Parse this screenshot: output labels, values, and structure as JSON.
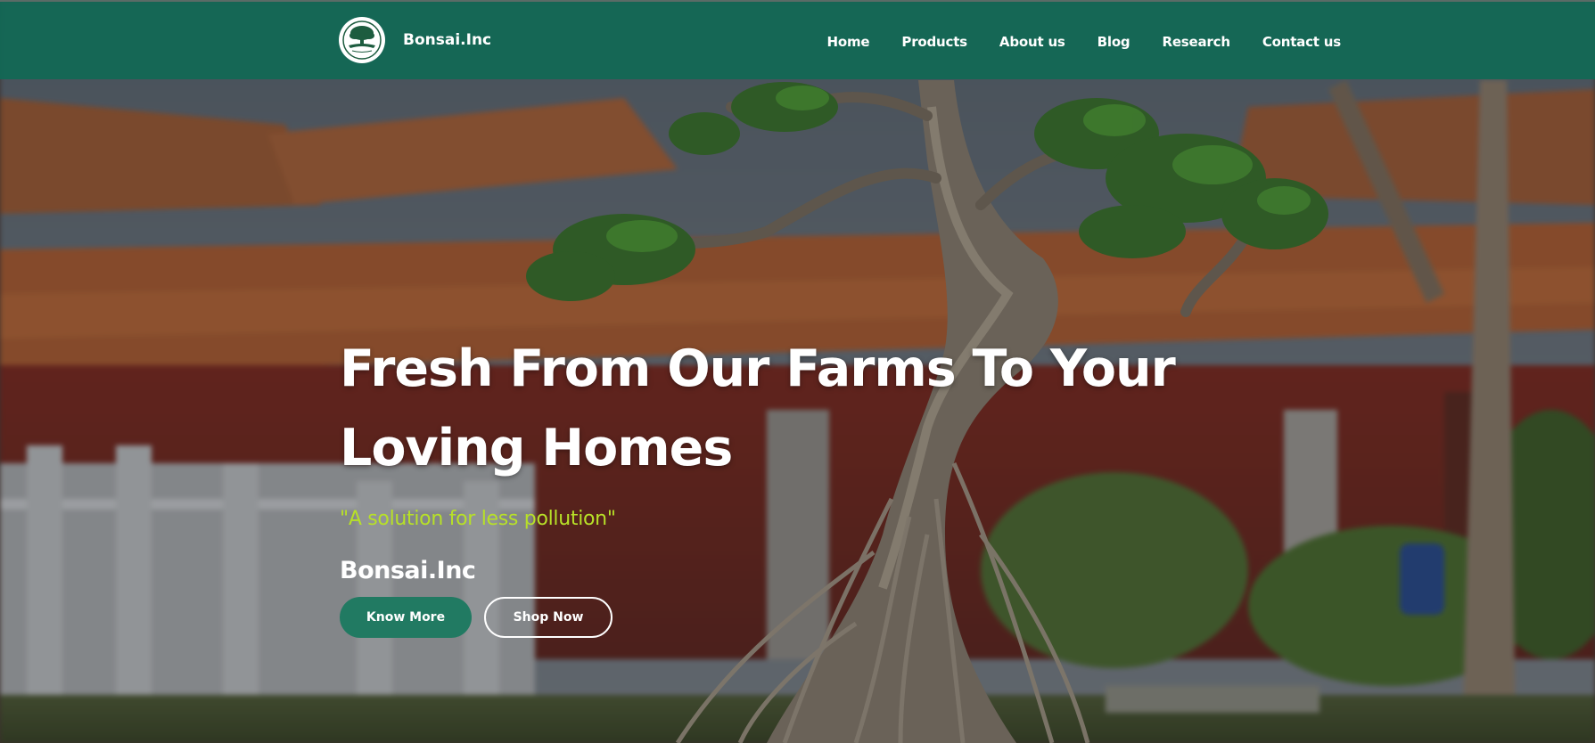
{
  "navbar": {
    "brand_name": "Bonsai.Inc",
    "logo_icon": "bonsai-tree-logo-icon",
    "links": [
      {
        "label": "Home"
      },
      {
        "label": "Products"
      },
      {
        "label": "About us"
      },
      {
        "label": "Blog"
      },
      {
        "label": "Research"
      },
      {
        "label": "Contact us"
      }
    ]
  },
  "hero": {
    "headline": "Fresh From Our Farms To Your Loving Homes",
    "tagline": "\"A solution for less pollution\"",
    "sub_brand": "Bonsai.Inc",
    "buttons": {
      "primary_label": "Know More",
      "secondary_label": "Shop Now"
    }
  },
  "colors": {
    "navbar_bg": "#116855",
    "primary_button": "#217a62",
    "tagline": "#b7e028",
    "text": "#ffffff"
  }
}
